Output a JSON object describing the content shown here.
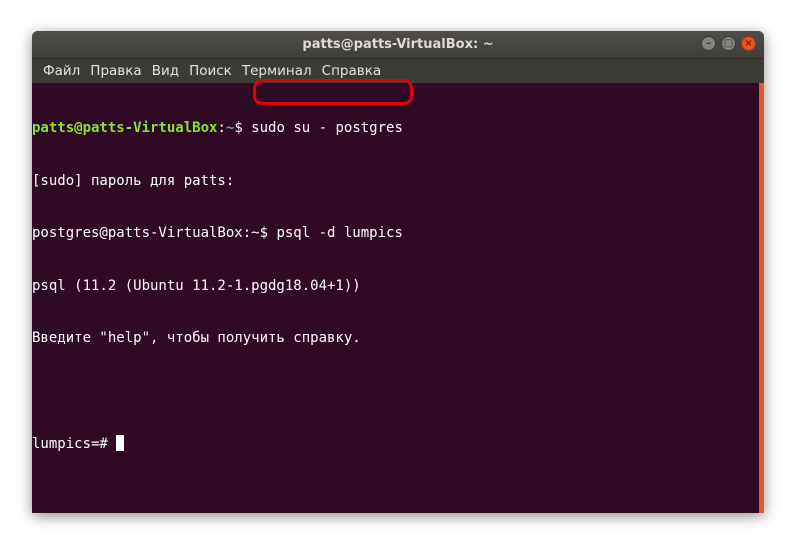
{
  "window": {
    "title": "patts@patts-VirtualBox: ~",
    "controls": {
      "minimize": "–",
      "maximize": "□",
      "close": "×"
    }
  },
  "menu": {
    "items": [
      "Файл",
      "Правка",
      "Вид",
      "Поиск",
      "Терминал",
      "Справка"
    ]
  },
  "terminal": {
    "line1": {
      "user": "patts@patts-VirtualBox",
      "sep": ":",
      "path": "~",
      "cmd": "$ sudo su - postgres"
    },
    "line2": "[sudo] пароль для patts:",
    "line3": {
      "prompt": "postgres@patts-VirtualBox:~$ ",
      "cmd": "psql -d lumpics"
    },
    "line4": "psql (11.2 (Ubuntu 11.2-1.pgdg18.04+1))",
    "line5": "Введите \"help\", чтобы получить справку.",
    "line6": "",
    "line7": "lumpics=# "
  },
  "colors": {
    "terminal_bg": "#300a24",
    "prompt_user": "#8ae234",
    "prompt_path": "#729fcf",
    "highlight": "#e1000b",
    "scrollbar": "#e05b2b"
  }
}
